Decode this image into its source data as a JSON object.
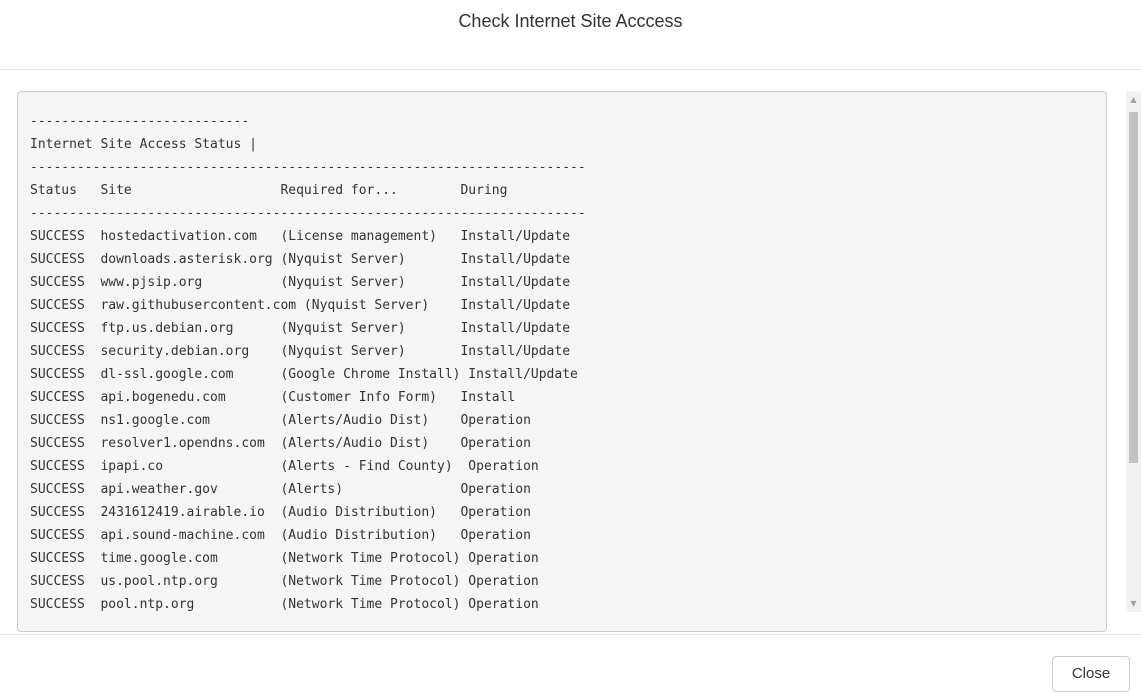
{
  "dialog": {
    "title": "Check Internet Site Acccess",
    "close_label": "Close"
  },
  "report": {
    "lines": [
      "----------------------------",
      "Internet Site Access Status |",
      "-----------------------------------------------------------------------",
      "Status   Site                   Required for...        During",
      "-----------------------------------------------------------------------",
      "SUCCESS  hostedactivation.com   (License management)   Install/Update",
      "SUCCESS  downloads.asterisk.org (Nyquist Server)       Install/Update",
      "SUCCESS  www.pjsip.org          (Nyquist Server)       Install/Update",
      "SUCCESS  raw.githubusercontent.com (Nyquist Server)    Install/Update",
      "SUCCESS  ftp.us.debian.org      (Nyquist Server)       Install/Update",
      "SUCCESS  security.debian.org    (Nyquist Server)       Install/Update",
      "SUCCESS  dl-ssl.google.com      (Google Chrome Install) Install/Update",
      "SUCCESS  api.bogenedu.com       (Customer Info Form)   Install",
      "SUCCESS  ns1.google.com         (Alerts/Audio Dist)    Operation",
      "SUCCESS  resolver1.opendns.com  (Alerts/Audio Dist)    Operation",
      "SUCCESS  ipapi.co               (Alerts - Find County)  Operation",
      "SUCCESS  api.weather.gov        (Alerts)               Operation",
      "SUCCESS  2431612419.airable.io  (Audio Distribution)   Operation",
      "SUCCESS  api.sound-machine.com  (Audio Distribution)   Operation",
      "SUCCESS  time.google.com        (Network Time Protocol) Operation",
      "SUCCESS  us.pool.ntp.org        (Network Time Protocol) Operation",
      "SUCCESS  pool.ntp.org           (Network Time Protocol) Operation"
    ]
  },
  "scrollbar": {
    "up_icon": "triangle-up",
    "down_icon": "triangle-down"
  }
}
